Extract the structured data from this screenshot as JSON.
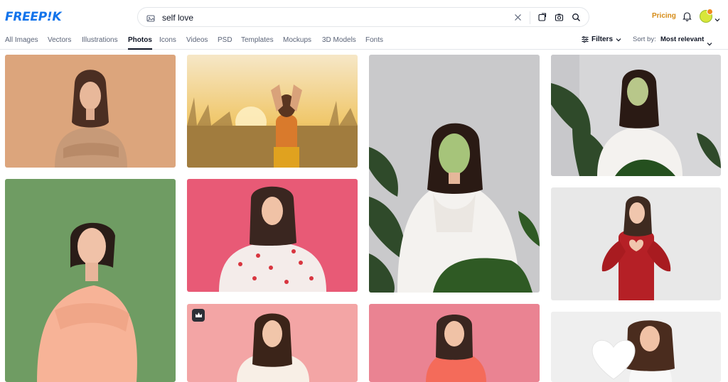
{
  "brand": {
    "logo_text": "FREEP!K",
    "accent": "#1273eb"
  },
  "search": {
    "value": "self love",
    "placeholder": ""
  },
  "header": {
    "pricing_label": "Pricing",
    "pricing_color": "#d58a14"
  },
  "tabs": [
    {
      "label": "All Images",
      "active": false
    },
    {
      "label": "Vectors",
      "active": false
    },
    {
      "label": "Illustrations",
      "active": false
    },
    {
      "label": "Photos",
      "active": true
    },
    {
      "label": "Icons",
      "active": false
    },
    {
      "label": "Videos",
      "active": false
    },
    {
      "label": "PSD",
      "active": false
    },
    {
      "label": "Templates",
      "active": false
    },
    {
      "label": "Mockups",
      "active": false
    },
    {
      "label": "3D Models",
      "active": false
    },
    {
      "label": "Fonts",
      "active": false
    }
  ],
  "toolbar": {
    "filters_label": "Filters",
    "sort_label": "Sort by:",
    "sort_value": "Most relevant"
  },
  "results": [
    {
      "subject": "woman-hugging-self-beige",
      "bg": "#d9a07a"
    },
    {
      "subject": "woman-heart-hands-sunset-field",
      "bg": "#e8c27a"
    },
    {
      "subject": "woman-heart-hands-white-robe",
      "bg": "#c9c9cb"
    },
    {
      "subject": "woman-heart-hands-robe-plants",
      "bg": "#d8d8da"
    },
    {
      "subject": "woman-hugging-self-green",
      "bg": "#6f9c63"
    },
    {
      "subject": "woman-heart-sweater-pink",
      "bg": "#e85a76"
    },
    {
      "subject": "woman-red-sweater-heart-hands",
      "bg": "#e6e6e6"
    },
    {
      "subject": "woman-heart-hands-pink-premium",
      "bg": "#f2a6a6",
      "premium": true
    },
    {
      "subject": "woman-hugging-self-pink",
      "bg": "#e87e8e"
    },
    {
      "subject": "woman-paper-heart",
      "bg": "#eeeeee"
    }
  ]
}
